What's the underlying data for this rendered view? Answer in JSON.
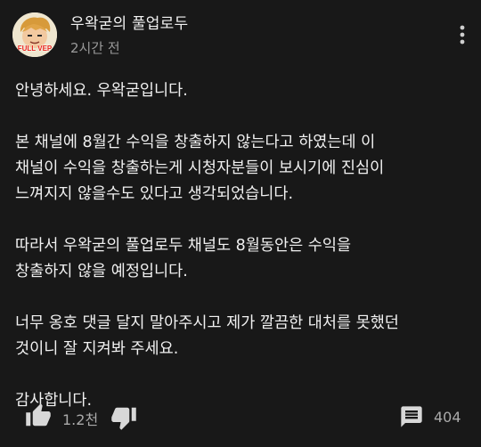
{
  "post": {
    "channel_name": "우왁굳의 풀업로두",
    "time": "2시간 전",
    "avatar_badge": "FULL VEP",
    "paragraphs": [
      {
        "lines": [
          "안녕하세요. 우왁굳입니다."
        ]
      },
      {
        "lines": [
          "본 채널에 8월간 수익을 창출하지 않는다고 하였는데 이",
          "채널이 수익을 창출하는게 시청자분들이 보시기에 진심이",
          "느껴지지 않을수도 있다고 생각되었습니다."
        ]
      },
      {
        "lines": [
          "따라서 우왁굳의 풀업로두 채널도 8월동안은 수익을",
          "창출하지 않을 예정입니다."
        ]
      },
      {
        "lines": [
          "너무 옹호 댓글 달지 말아주시고 제가 깔끔한 대처를 못했던",
          "것이니 잘 지켜봐 주세요."
        ]
      },
      {
        "lines": [
          "감사합니다."
        ]
      }
    ]
  },
  "actions": {
    "like_count": "1.2천",
    "comment_count": "404"
  },
  "icons": {
    "more": "more-vert-icon",
    "like": "thumb-up-icon",
    "dislike": "thumb-down-icon",
    "comment": "comment-icon"
  }
}
